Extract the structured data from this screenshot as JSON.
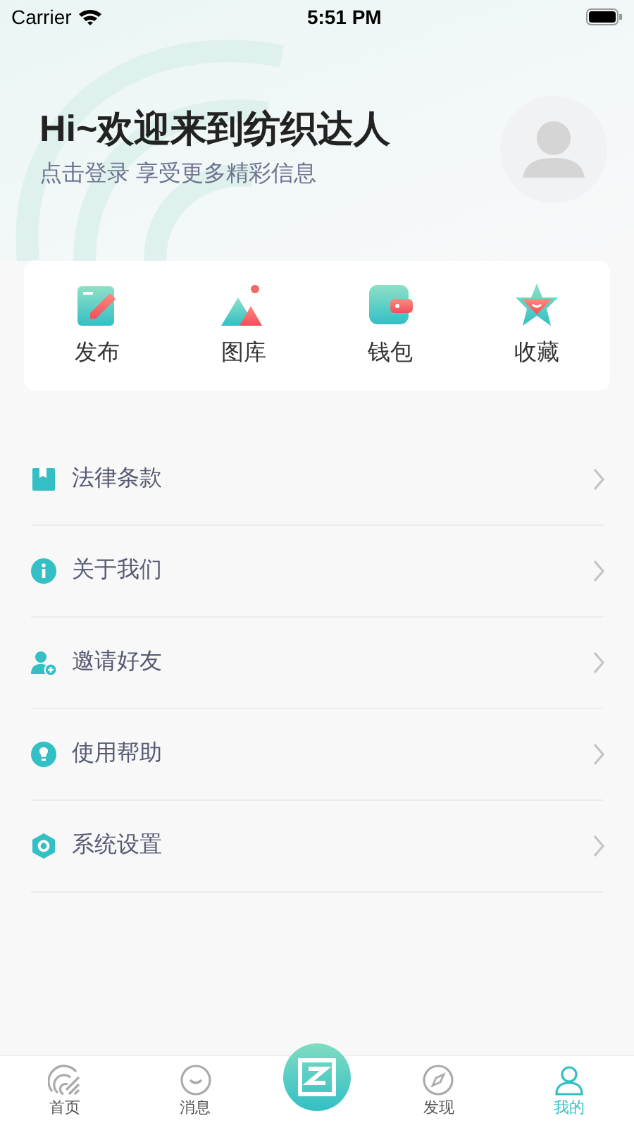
{
  "status_bar": {
    "carrier": "Carrier",
    "time": "5:51 PM"
  },
  "header": {
    "greeting": "Hi~欢迎来到纺织达人",
    "subtitle": "点击登录 享受更多精彩信息"
  },
  "quick_actions": [
    {
      "kind": "publish",
      "label": "发布"
    },
    {
      "kind": "gallery",
      "label": "图库"
    },
    {
      "kind": "wallet",
      "label": "钱包"
    },
    {
      "kind": "favorite",
      "label": "收藏"
    }
  ],
  "menu": [
    {
      "kind": "legal",
      "label": "法律条款"
    },
    {
      "kind": "about",
      "label": "关于我们"
    },
    {
      "kind": "invite",
      "label": "邀请好友"
    },
    {
      "kind": "help",
      "label": "使用帮助"
    },
    {
      "kind": "settings",
      "label": "系统设置"
    }
  ],
  "tab_bar": [
    {
      "kind": "home",
      "label": "首页",
      "selected": false
    },
    {
      "kind": "messages",
      "label": "消息",
      "selected": false
    },
    {
      "kind": "center",
      "selected": false
    },
    {
      "kind": "discover",
      "label": "发现",
      "selected": false
    },
    {
      "kind": "mine",
      "label": "我的",
      "selected": true
    }
  ]
}
